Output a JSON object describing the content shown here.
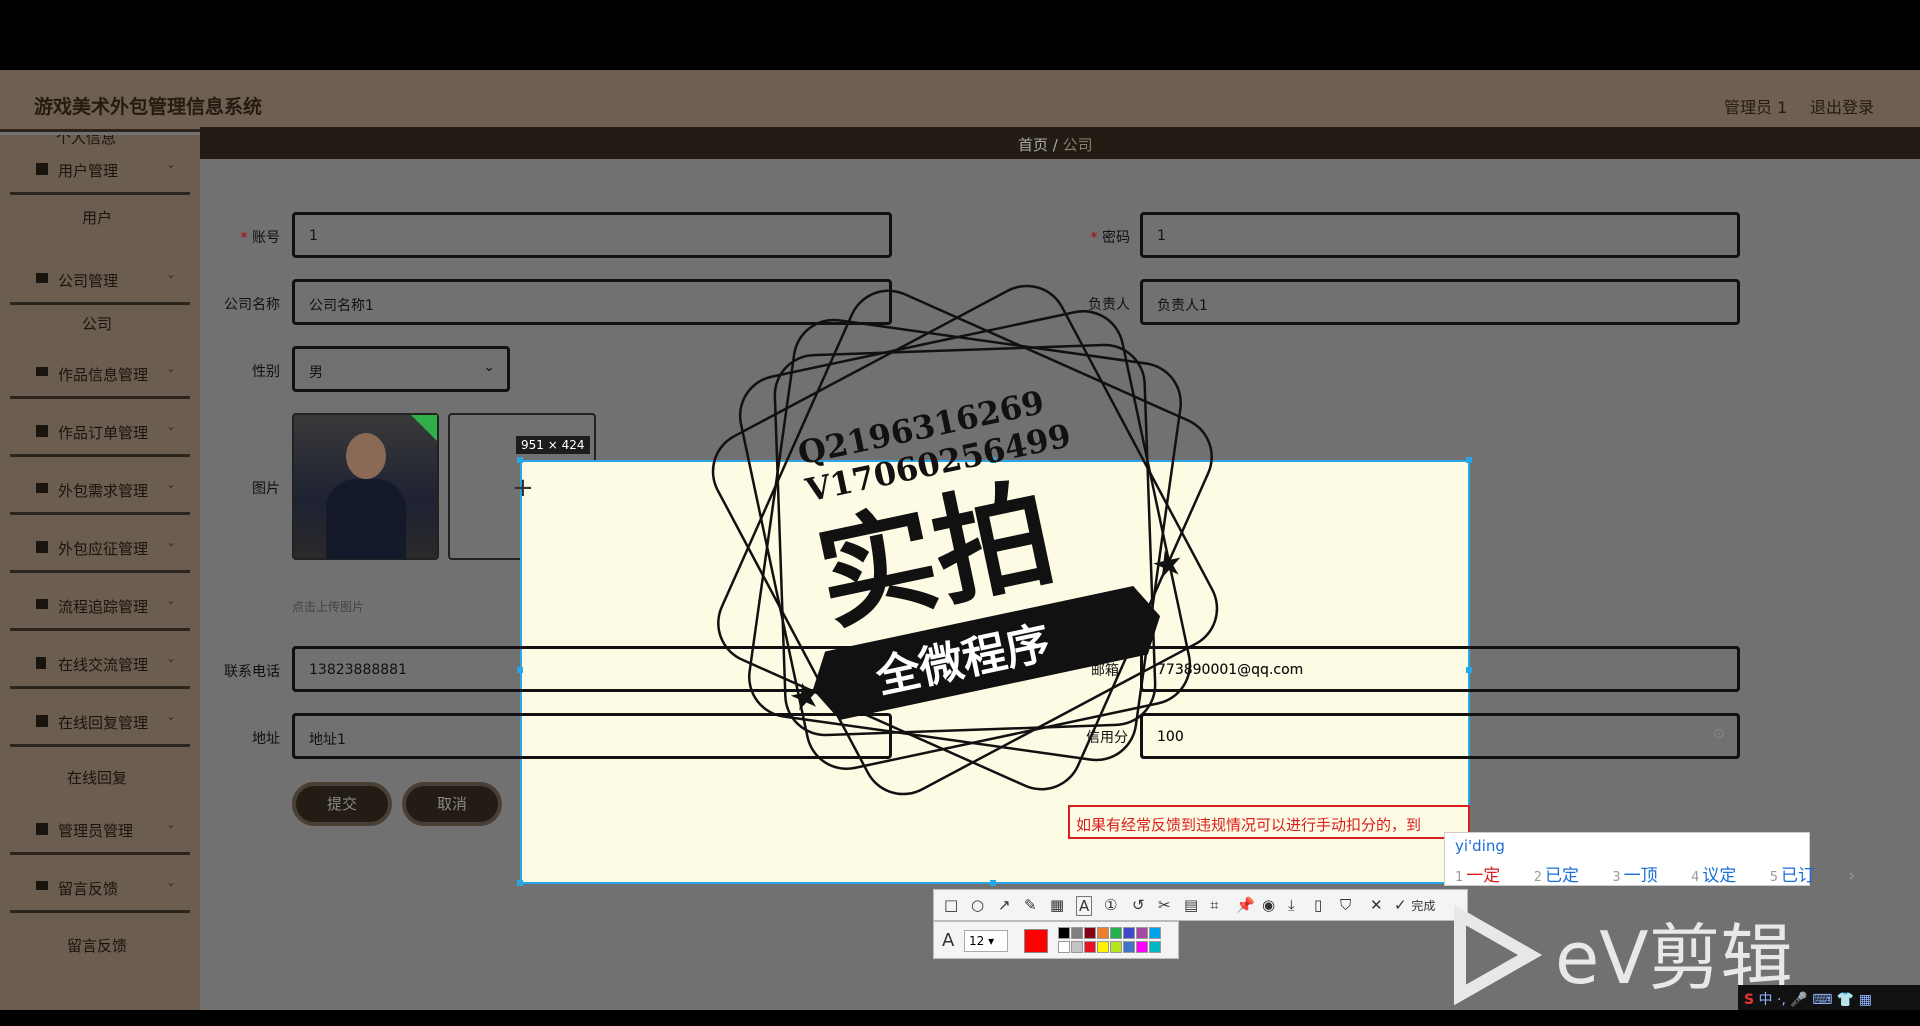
{
  "app": {
    "title": "游戏美术外包管理信息系统"
  },
  "header": {
    "user_label": "管理员 1",
    "logout_label": "退出登录"
  },
  "sidebar": {
    "clipped_item": "个人信息",
    "items": [
      {
        "label": "用户管理",
        "icon": "grid-icon"
      },
      {
        "sub": "用户"
      },
      {
        "label": "公司管理",
        "icon": "monitor-icon"
      },
      {
        "sub": "公司"
      },
      {
        "label": "作品信息管理",
        "icon": "list-icon"
      },
      {
        "label": "作品订单管理",
        "icon": "grid-icon"
      },
      {
        "label": "外包需求管理",
        "icon": "monitor-icon"
      },
      {
        "label": "外包应征管理",
        "icon": "grid-icon"
      },
      {
        "label": "流程追踪管理",
        "icon": "monitor-icon"
      },
      {
        "label": "在线交流管理",
        "icon": "bar-chart-icon"
      },
      {
        "label": "在线回复管理",
        "icon": "grid-icon"
      },
      {
        "sub": "在线回复"
      },
      {
        "label": "管理员管理",
        "icon": "grid-icon"
      },
      {
        "label": "留言反馈",
        "icon": "list-icon"
      },
      {
        "sub": "留言反馈"
      }
    ]
  },
  "breadcrumb": {
    "home": "首页",
    "sep": "/",
    "current": "公司"
  },
  "form": {
    "account_label": "账号",
    "account_value": "1",
    "password_label": "密码",
    "password_value": "1",
    "company_label": "公司名称",
    "company_value": "公司名称1",
    "manager_label": "负责人",
    "manager_value": "负责人1",
    "gender_label": "性别",
    "gender_value": "男",
    "image_label": "图片",
    "upload_hint": "点击上传图片",
    "phone_label": "联系电话",
    "phone_value": "13823888881",
    "email_label": "邮箱",
    "email_value": "773890001@qq.com",
    "address_label": "地址",
    "address_value": "地址1",
    "credit_label": "信用分",
    "credit_value": "100",
    "submit_label": "提交",
    "cancel_label": "取消"
  },
  "screenshot_tool": {
    "size_badge": "951 × 424",
    "annotation_text": "如果有经常反馈到违规情况可以进行手动扣分的，到",
    "toolbar_done": "完成",
    "font_size": "12",
    "palette": [
      "#000000",
      "#7f7f7f",
      "#880015",
      "#ed7d31",
      "#22b14c",
      "#3f48cc",
      "#a349a4",
      "#00a2e8",
      "#ffffff",
      "#c3c3c3",
      "#e81123",
      "#fff200",
      "#b5e61d",
      "#4472c4",
      "#ff00ff",
      "#00b7c3"
    ],
    "current_color": "#ff0000"
  },
  "ime": {
    "pinyin": "yi'ding",
    "candidates": [
      "一定",
      "已定",
      "一顶",
      "议定",
      "已订"
    ]
  },
  "watermark": {
    "line1": "Q2196316269",
    "line2": "V17060256499",
    "main": "实拍",
    "ribbon": "全微程序"
  },
  "ev_logo": {
    "text": "eV剪辑"
  },
  "tray": {
    "text": "中"
  }
}
